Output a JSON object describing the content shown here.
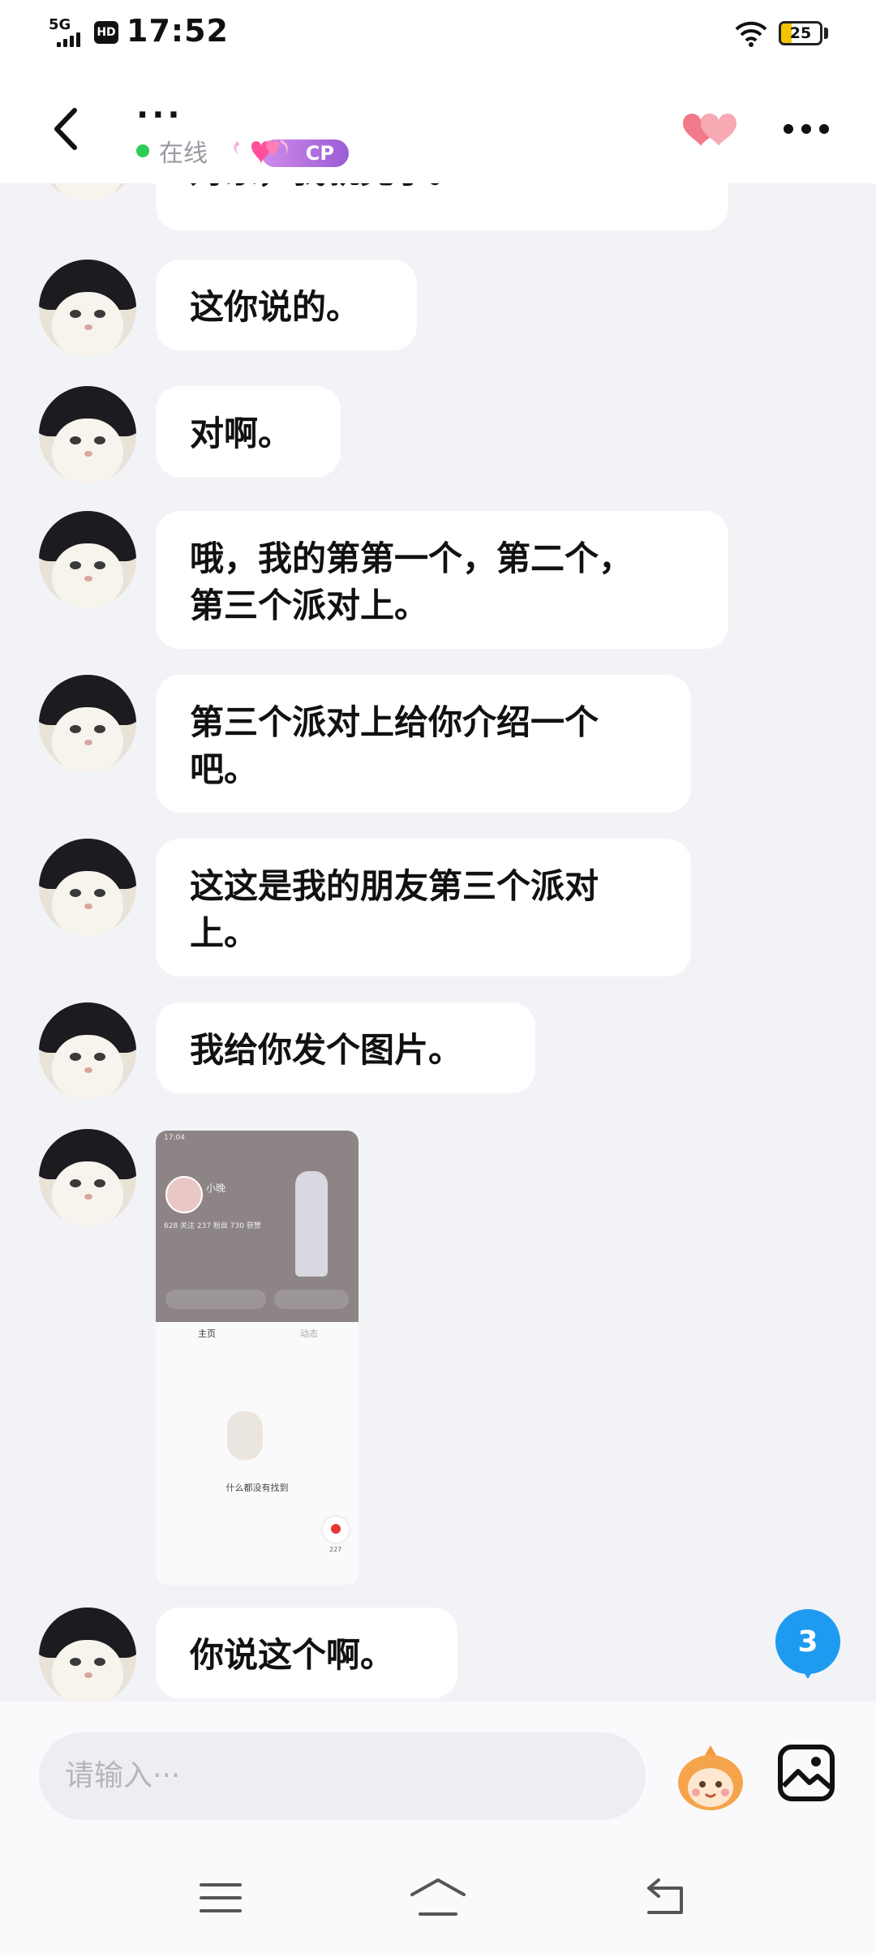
{
  "status_bar": {
    "network": "5G",
    "hd": "HD",
    "time": "17:52",
    "battery": "25"
  },
  "header": {
    "contact_name": "...",
    "status": "在线",
    "badge": "CP"
  },
  "messages": [
    {
      "type": "text",
      "text": "对象，我就完了。"
    },
    {
      "type": "text",
      "text": "这你说的。"
    },
    {
      "type": "text",
      "text": "对啊。"
    },
    {
      "type": "text",
      "line1": "哦，我的第第一个，第二个，",
      "line2": "第三个派对上。"
    },
    {
      "type": "text",
      "line1": "第三个派对上给你介绍一个",
      "line2": "吧。"
    },
    {
      "type": "text",
      "line1": "这这是我的朋友第三个派对",
      "line2": "上。"
    },
    {
      "type": "text",
      "text": "我给你发个图片。"
    },
    {
      "type": "image",
      "thumb": {
        "time": "17:04",
        "name": "小晚",
        "stats": "628 关注  237 粉丝  730 获赞",
        "tab_home": "主页",
        "tab_feed": "动态",
        "empty_text": "什么都没有找到",
        "likes": "227"
      }
    },
    {
      "type": "text",
      "text": "你说这个啊。"
    }
  ],
  "unread_count": "3",
  "input": {
    "placeholder": "请输入···"
  },
  "icons": {
    "back": "back-arrow-icon",
    "hearts": "hearts-icon",
    "more": "more-icon",
    "emoji": "mascot-emoji-icon",
    "image": "image-icon",
    "nav_menu": "menu-icon",
    "nav_home": "home-icon",
    "nav_back": "return-icon"
  },
  "colors": {
    "online": "#2fcc57",
    "badge": "#9b5cd6",
    "unread": "#1e9bf0",
    "background": "#f2f3f7"
  }
}
